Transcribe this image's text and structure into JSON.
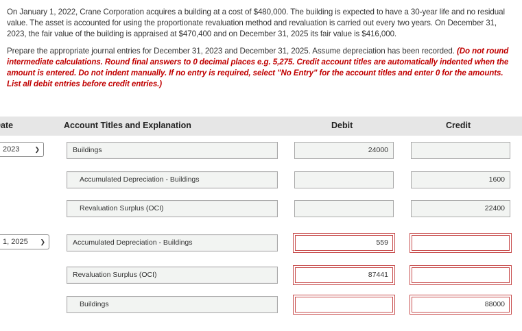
{
  "problem": {
    "paragraph1": "On January 1, 2022, Crane Corporation acquires a building at a cost of $480,000. The building is expected to have a 30-year life and no residual value. The asset is accounted for using the proportionate revaluation method and revaluation is carried out every two years. On December 31, 2023, the fair value of the building is appraised at $470,400 and on December 31, 2025 its fair value is $416,000.",
    "paragraph2_text": "Prepare the appropriate journal entries for December 31, 2023 and December 31, 2025. Assume depreciation has been recorded.",
    "paragraph2_instructions": "(Do not round intermediate calculations. Round final answers to 0 decimal places e.g. 5,275. Credit account titles are automatically indented when the amount is entered. Do not indent manually. If no entry is required, select \"No Entry\" for the account titles and enter 0 for the amounts. List all debit entries before credit entries.)"
  },
  "table": {
    "headers": {
      "date": "Date",
      "account": "Account Titles and Explanation",
      "debit": "Debit",
      "credit": "Credit"
    },
    "dates": [
      "2023",
      "1, 2025"
    ],
    "rows": [
      {
        "account": "Buildings",
        "debit": "24000",
        "credit": "",
        "indented": false,
        "error": false
      },
      {
        "account": "Accumulated Depreciation - Buildings",
        "debit": "",
        "credit": "1600",
        "indented": true,
        "error": false
      },
      {
        "account": "Revaluation Surplus (OCI)",
        "debit": "",
        "credit": "22400",
        "indented": true,
        "error": false
      },
      {
        "account": "Accumulated Depreciation - Buildings",
        "debit": "559",
        "credit": "",
        "indented": false,
        "error": true
      },
      {
        "account": "Revaluation Surplus (OCI)",
        "debit": "87441",
        "credit": "",
        "indented": false,
        "error": true
      },
      {
        "account": "Buildings",
        "debit": "",
        "credit": "88000",
        "indented": true,
        "error": true
      }
    ]
  },
  "colors": {
    "instruction_red": "#c00000",
    "error_border": "#c74b4b",
    "header_bg": "#e6e6e6"
  }
}
